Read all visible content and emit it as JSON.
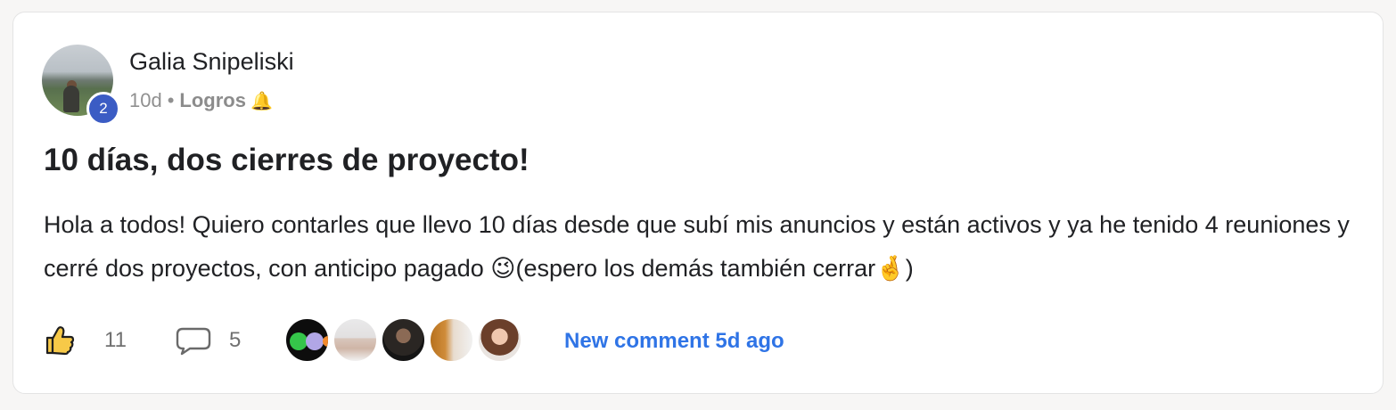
{
  "post": {
    "author": {
      "name": "Galia Snipeliski",
      "level": "2"
    },
    "meta": {
      "time_ago": "10d",
      "separator": "•",
      "category": "Logros",
      "category_emoji": "🔔"
    },
    "title": "10 días, dos cierres de proyecto!",
    "body": "Hola a todos! Quiero contarles que llevo 10 días desde que subí mis anuncios y están activos y ya he tenido 4 reuniones y cerré dos proyectos, con anticipo pagado 😉(espero los demás también cerrar🤞)",
    "footer": {
      "likes": "11",
      "comments": "5",
      "commenter_avatars": [
        "avatar-1",
        "avatar-2",
        "avatar-3",
        "avatar-4",
        "avatar-5"
      ],
      "new_comment_label": "New comment 5d ago"
    }
  },
  "colors": {
    "accent_link": "#2f74e6",
    "level_badge": "#3b5cc4",
    "muted_text": "#909090",
    "card_border": "#e4e4e4"
  }
}
